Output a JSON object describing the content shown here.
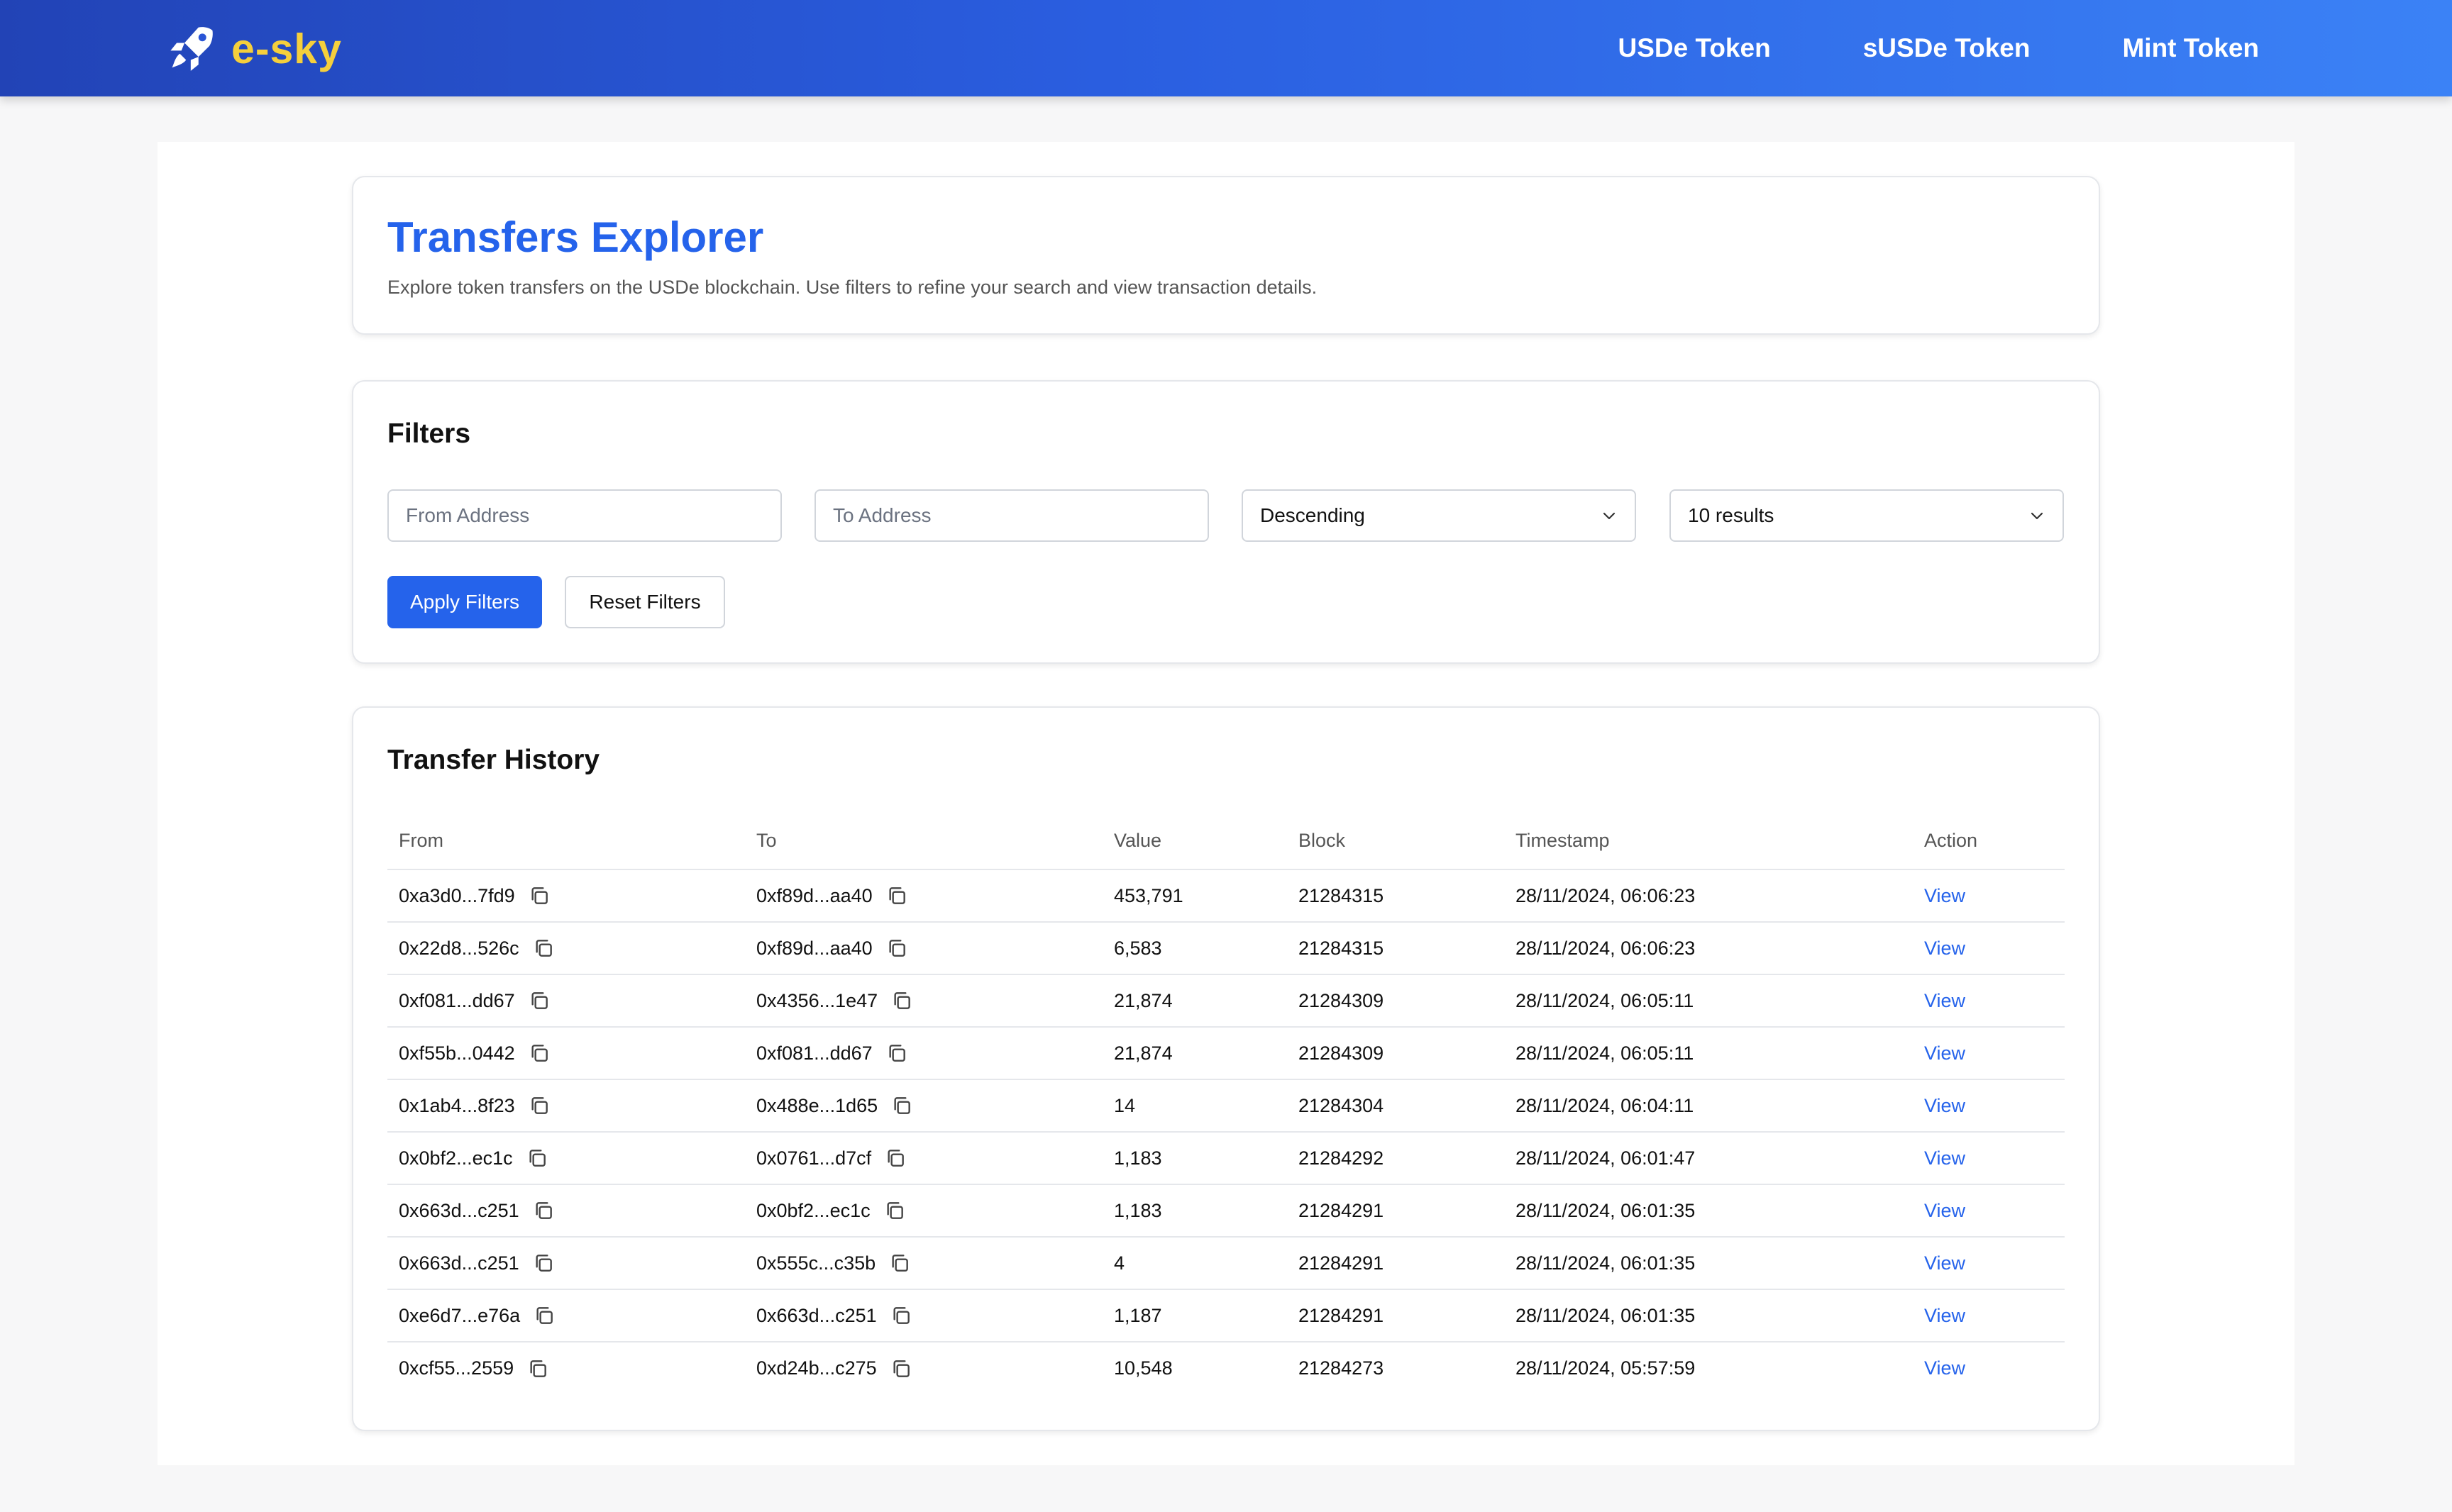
{
  "brand": {
    "name": "e-sky",
    "logo_icon": "rocket-icon"
  },
  "nav": [
    {
      "label": "USDe Token"
    },
    {
      "label": "sUSDe Token"
    },
    {
      "label": "Mint Token"
    }
  ],
  "header": {
    "title": "Transfers Explorer",
    "subtitle": "Explore token transfers on the USDe blockchain. Use filters to refine your search and view transaction details."
  },
  "filters": {
    "title": "Filters",
    "from_placeholder": "From Address",
    "to_placeholder": "To Address",
    "sort_value": "Descending",
    "limit_value": "10 results",
    "apply_label": "Apply Filters",
    "reset_label": "Reset Filters"
  },
  "history": {
    "title": "Transfer History",
    "columns": [
      "From",
      "To",
      "Value",
      "Block",
      "Timestamp",
      "Action"
    ],
    "rows": [
      {
        "from": "0xa3d0...7fd9",
        "to": "0xf89d...aa40",
        "value": "453,791",
        "block": "21284315",
        "timestamp": "28/11/2024, 06:06:23",
        "action": "View"
      },
      {
        "from": "0x22d8...526c",
        "to": "0xf89d...aa40",
        "value": "6,583",
        "block": "21284315",
        "timestamp": "28/11/2024, 06:06:23",
        "action": "View"
      },
      {
        "from": "0xf081...dd67",
        "to": "0x4356...1e47",
        "value": "21,874",
        "block": "21284309",
        "timestamp": "28/11/2024, 06:05:11",
        "action": "View"
      },
      {
        "from": "0xf55b...0442",
        "to": "0xf081...dd67",
        "value": "21,874",
        "block": "21284309",
        "timestamp": "28/11/2024, 06:05:11",
        "action": "View"
      },
      {
        "from": "0x1ab4...8f23",
        "to": "0x488e...1d65",
        "value": "14",
        "block": "21284304",
        "timestamp": "28/11/2024, 06:04:11",
        "action": "View"
      },
      {
        "from": "0x0bf2...ec1c",
        "to": "0x0761...d7cf",
        "value": "1,183",
        "block": "21284292",
        "timestamp": "28/11/2024, 06:01:47",
        "action": "View"
      },
      {
        "from": "0x663d...c251",
        "to": "0x0bf2...ec1c",
        "value": "1,183",
        "block": "21284291",
        "timestamp": "28/11/2024, 06:01:35",
        "action": "View"
      },
      {
        "from": "0x663d...c251",
        "to": "0x555c...c35b",
        "value": "4",
        "block": "21284291",
        "timestamp": "28/11/2024, 06:01:35",
        "action": "View"
      },
      {
        "from": "0xe6d7...e76a",
        "to": "0x663d...c251",
        "value": "1,187",
        "block": "21284291",
        "timestamp": "28/11/2024, 06:01:35",
        "action": "View"
      },
      {
        "from": "0xcf55...2559",
        "to": "0xd24b...c275",
        "value": "10,548",
        "block": "21284273",
        "timestamp": "28/11/2024, 05:57:59",
        "action": "View"
      }
    ]
  },
  "colors": {
    "accent": "#2563eb",
    "brand_text": "#f5cf3c",
    "nav_gradient_start": "#2243b6",
    "nav_gradient_end": "#3b82f6"
  }
}
